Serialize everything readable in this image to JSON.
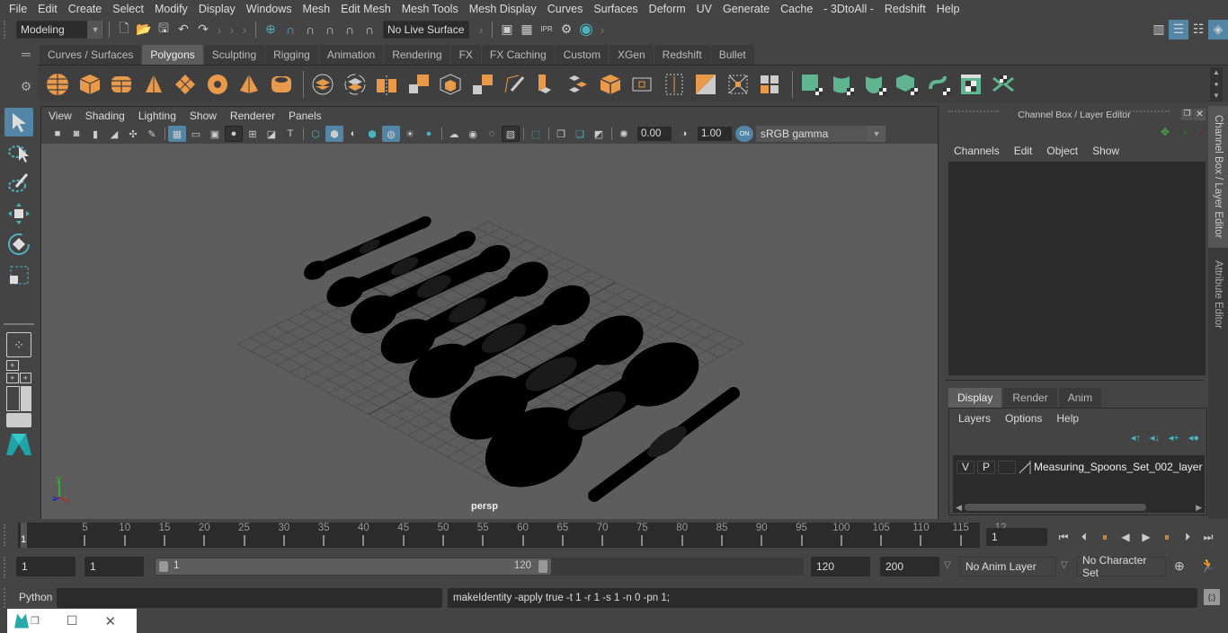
{
  "menubar": {
    "items": [
      "File",
      "Edit",
      "Create",
      "Select",
      "Modify",
      "Display",
      "Windows",
      "Mesh",
      "Edit Mesh",
      "Mesh Tools",
      "Mesh Display",
      "Curves",
      "Surfaces",
      "Deform",
      "UV",
      "Generate",
      "Cache",
      "- 3DtoAll -",
      "Redshift",
      "Help"
    ]
  },
  "statusline": {
    "mode": "Modeling",
    "live_surface": "No Live Surface"
  },
  "shelf": {
    "tabs": [
      "Curves / Surfaces",
      "Polygons",
      "Sculpting",
      "Rigging",
      "Animation",
      "Rendering",
      "FX",
      "FX Caching",
      "Custom",
      "XGen",
      "Redshift",
      "Bullet"
    ],
    "active_tab": "Polygons",
    "icons_primitives": [
      "poly-sphere",
      "poly-cube",
      "poly-cylinder",
      "poly-cone",
      "poly-plane",
      "poly-torus",
      "poly-pyramid",
      "poly-pipe"
    ],
    "icons_tools": [
      "combine",
      "separate",
      "mirror",
      "smooth",
      "bevel",
      "extrude",
      "bridge",
      "multi-cut",
      "extract",
      "target-weld",
      "bevel-box",
      "edge-loop",
      "insert-loop",
      "slide",
      "merge",
      "append"
    ],
    "icons_uv": [
      "planar-map",
      "cylindrical-map",
      "spherical-map",
      "automatic-map",
      "unfold",
      "uv-editor",
      "layout"
    ],
    "colors": {
      "orange": "#e8994a",
      "green": "#5fb58f"
    }
  },
  "viewport": {
    "menu": [
      "View",
      "Shading",
      "Lighting",
      "Show",
      "Renderer",
      "Panels"
    ],
    "exposure": "0.00",
    "gamma": "1.00",
    "color_space": "sRGB gamma",
    "camera_label": "persp",
    "axis": {
      "x": "x",
      "y": "y",
      "z": "z"
    }
  },
  "channel_box": {
    "title": "Channel Box / Layer Editor",
    "menu": [
      "Channels",
      "Edit",
      "Object",
      "Show"
    ]
  },
  "layer_editor": {
    "tabs": [
      "Display",
      "Render",
      "Anim"
    ],
    "active_tab": "Display",
    "menu": [
      "Layers",
      "Options",
      "Help"
    ],
    "layers": [
      {
        "v": "V",
        "p": "P",
        "name": "Measuring_Spoons_Set_002_layer"
      }
    ]
  },
  "side_tabs": [
    "Channel Box / Layer Editor",
    "Attribute Editor"
  ],
  "timeline": {
    "ticks": [
      5,
      10,
      15,
      20,
      25,
      30,
      35,
      40,
      45,
      50,
      55,
      60,
      65,
      70,
      75,
      80,
      85,
      90,
      95,
      100,
      105,
      110,
      115,
      "12"
    ],
    "current_frame_marker": "1",
    "current_frame": "1",
    "start": 1,
    "end": 120
  },
  "range": {
    "start_time": "1",
    "playback_start": "1",
    "slider_start": "1",
    "slider_end": "120",
    "playback_end": "120",
    "end_time": "200",
    "anim_layer": "No Anim Layer",
    "character_set": "No Character Set"
  },
  "command": {
    "language": "Python",
    "input": "",
    "result": "makeIdentity -apply true -t 1 -r 1 -s 1 -n 0 -pn 1;"
  }
}
